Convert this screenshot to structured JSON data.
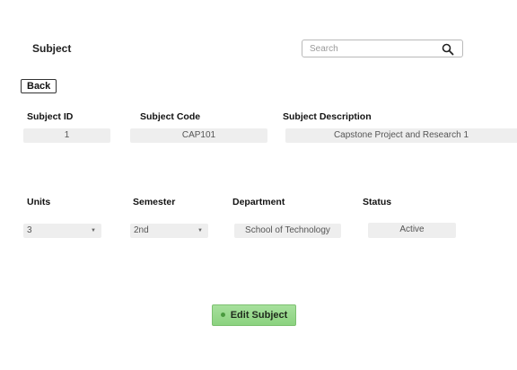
{
  "header": {
    "title": "Subject",
    "search_placeholder": "Search"
  },
  "back_label": "Back",
  "fields": {
    "subject_id": {
      "label": "Subject ID",
      "value": "1"
    },
    "subject_code": {
      "label": "Subject Code",
      "value": "CAP101"
    },
    "subject_description": {
      "label": "Subject Description",
      "value": "Capstone Project and Research 1"
    },
    "units": {
      "label": "Units",
      "value": "3"
    },
    "semester": {
      "label": "Semester",
      "value": "2nd"
    },
    "department": {
      "label": "Department",
      "value": "School of Technology"
    },
    "status": {
      "label": "Status",
      "value": "Active"
    }
  },
  "edit_button_label": "Edit Subject",
  "icons": {
    "search": "search-icon",
    "dropdown": "chevron-down-icon"
  },
  "colors": {
    "edit_button": "#8bd27f",
    "field_background": "#eeeeee"
  }
}
